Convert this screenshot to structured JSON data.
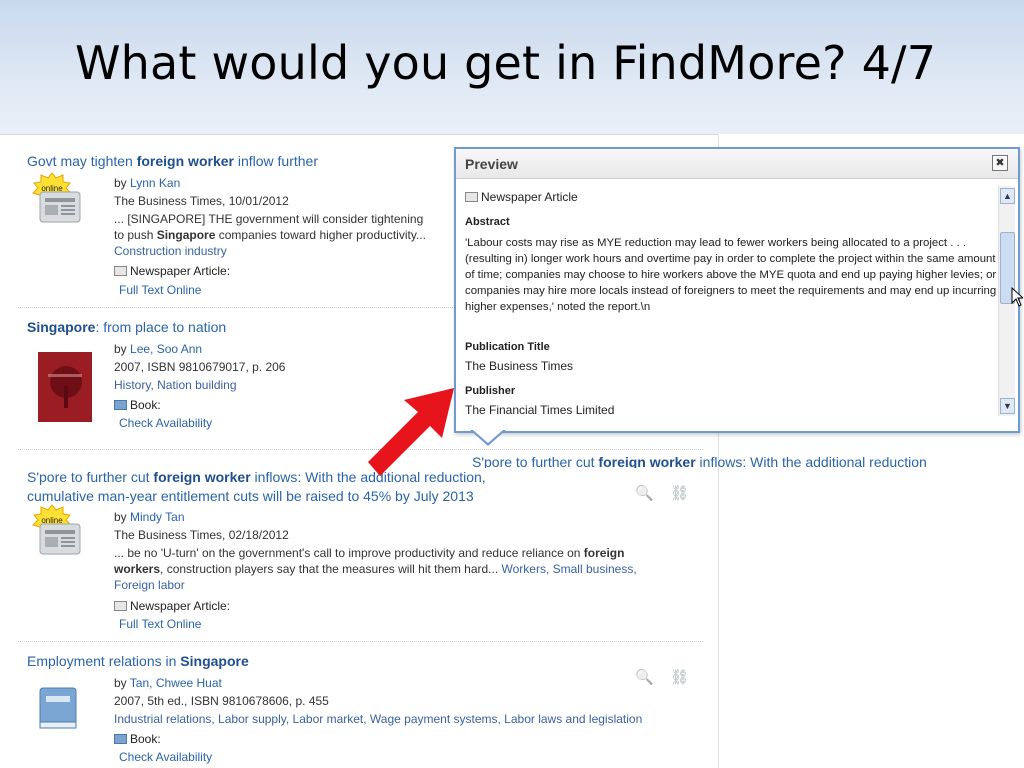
{
  "slide": {
    "title": "What would you get in FindMore? 4/7"
  },
  "results": [
    {
      "title_pre": "Govt may tighten ",
      "title_bold": "foreign worker",
      "title_post": " inflow further",
      "author_prefix": "by ",
      "author": "Lynn Kan",
      "source": "The Business Times, 10/01/2012",
      "snippet_1": "... [SINGAPORE] THE government will consider tightening",
      "snippet_2_pre": "to push ",
      "snippet_2_bold": "Singapore",
      "snippet_2_post": " companies toward higher productivity...",
      "subjects": "Construction industry",
      "type": "Newspaper Article:",
      "action": "Full Text Online",
      "badge": "online"
    },
    {
      "title_bold": "Singapore",
      "title_post": ": from place to nation",
      "author_prefix": "by ",
      "author": "Lee, Soo Ann",
      "source": "2007, ISBN 9810679017, p. 206",
      "subjects": "History, Nation building",
      "type": "Book:",
      "action": "Check Availability"
    },
    {
      "title_pre": "S'pore to further cut ",
      "title_bold": "foreign worker",
      "title_post": " inflows: With the additional reduction,",
      "title_line2": "cumulative man-year entitlement cuts will be raised to 45% by July 2013",
      "author_prefix": "by ",
      "author": "Mindy Tan",
      "source": "The Business Times, 02/18/2012",
      "snippet_1_pre": "... be no 'U-turn' on the government's call to improve productivity and reduce reliance on ",
      "snippet_1_bold": "foreign",
      "snippet_2_bold": "workers",
      "snippet_2_post": ", construction players say that the measures will hit them hard... ",
      "snippet_2_subjects": "Workers, Small business,",
      "subjects": "Foreign labor",
      "type": "Newspaper Article:",
      "action": "Full Text Online",
      "badge": "online"
    },
    {
      "title_pre": "Employment relations in ",
      "title_bold": "Singapore",
      "author_prefix": "by ",
      "author": "Tan, Chwee Huat",
      "source": "2007, 5th ed., ISBN 9810678606, p. 455",
      "subjects": "Industrial relations, Labor supply, Labor market, Wage payment systems, Labor laws and legislation",
      "type": "Book:",
      "action": "Check Availability"
    }
  ],
  "preview": {
    "title": "Preview",
    "close": "✖",
    "doc_type": "Newspaper Article",
    "abstract_label": "Abstract",
    "abstract": "'Labour costs may rise as MYE reduction may lead to fewer workers being allocated to a project . . . (resulting in) longer work hours and overtime pay in order to complete the project within the same amount of time; companies may choose to hire workers above the MYE quota and end up paying higher levies; or companies may hire more locals instead of foreigners to meet the requirements and may end up incurring higher expenses,' noted the report.\\n",
    "pub_title_label": "Publication Title",
    "pub_title": "The Business Times",
    "publisher_label": "Publisher",
    "publisher": "The Financial Times Limited",
    "scroll_up": "▲",
    "scroll_down": "▼"
  },
  "peek": {
    "pre": "S'pore to further cut ",
    "bold": "foreign worker",
    "post": " inflows: With the additional reduction"
  },
  "icons": {
    "search": "🔍",
    "link": "⛓",
    "arrow_color": "#e8141b"
  }
}
